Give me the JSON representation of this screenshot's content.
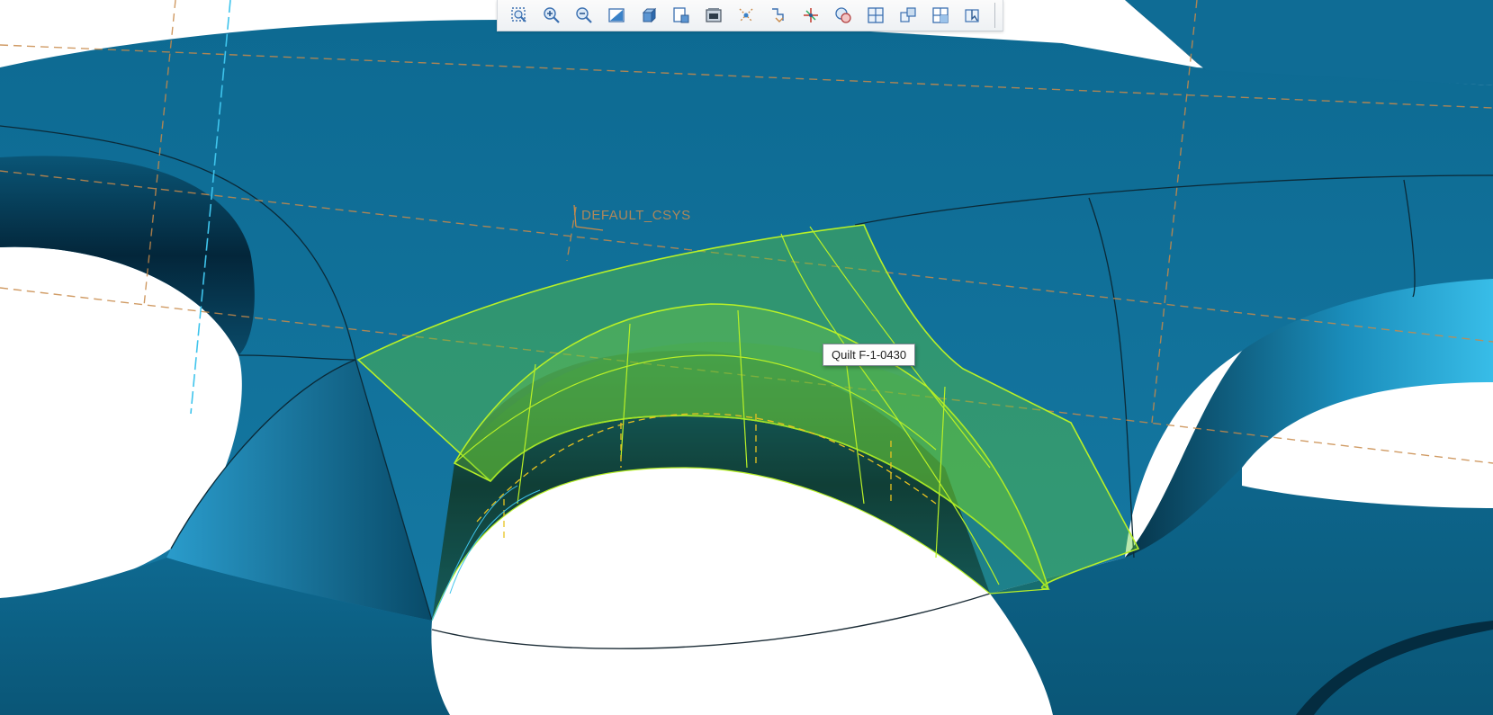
{
  "app": {
    "mode": "3D model graphics window"
  },
  "toolbar": {
    "buttons": [
      {
        "name": "refit",
        "icon": "refit-icon"
      },
      {
        "name": "zoom-in",
        "icon": "zoom-in-icon"
      },
      {
        "name": "zoom-out",
        "icon": "zoom-out-icon"
      },
      {
        "name": "repaint",
        "icon": "repaint-icon"
      },
      {
        "name": "display-style",
        "icon": "display-style-icon"
      },
      {
        "name": "saved-orientations",
        "icon": "saved-orientations-icon"
      },
      {
        "name": "view-manager",
        "icon": "view-manager-icon"
      },
      {
        "name": "datum-display",
        "icon": "datum-display-icon"
      },
      {
        "name": "annotation-display",
        "icon": "annotation-display-icon"
      },
      {
        "name": "spin-center",
        "icon": "spin-center-icon"
      },
      {
        "name": "show-hide",
        "icon": "show-hide-icon"
      },
      {
        "name": "plane-display",
        "icon": "plane-display-icon"
      },
      {
        "name": "axis-display",
        "icon": "axis-display-icon"
      },
      {
        "name": "csys-display",
        "icon": "csys-display-icon"
      },
      {
        "name": "point-display",
        "icon": "point-display-icon"
      }
    ]
  },
  "viewport": {
    "tooltip": "Quilt F-1-0430",
    "csys_label": "DEFAULT_CSYS",
    "colors": {
      "background": "#ffffff",
      "model_surface": "#0f6f97",
      "model_dark": "#053447",
      "highlight_fill": "#5dc83a",
      "highlight_edge": "#b8f028",
      "datum_plane": "#c88a4a",
      "datum_axis": "#3fc4ec"
    }
  }
}
